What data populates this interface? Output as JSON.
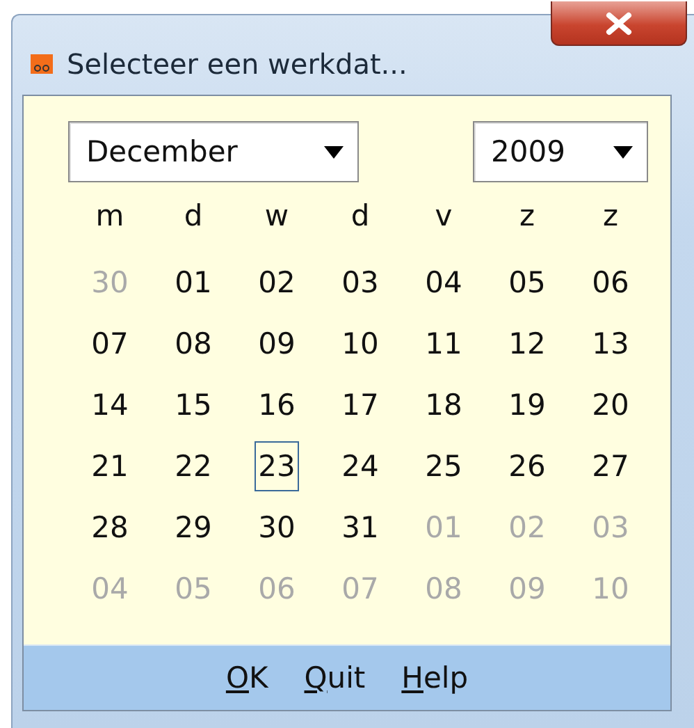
{
  "window": {
    "title": "Selecteer een werkdat..."
  },
  "month_select": {
    "value": "December"
  },
  "year_select": {
    "value": "2009"
  },
  "weekdays": [
    "m",
    "d",
    "w",
    "d",
    "v",
    "z",
    "z"
  ],
  "weeks": [
    [
      {
        "label": "30",
        "in_month": false,
        "selected": false
      },
      {
        "label": "01",
        "in_month": true,
        "selected": false
      },
      {
        "label": "02",
        "in_month": true,
        "selected": false
      },
      {
        "label": "03",
        "in_month": true,
        "selected": false
      },
      {
        "label": "04",
        "in_month": true,
        "selected": false
      },
      {
        "label": "05",
        "in_month": true,
        "selected": false
      },
      {
        "label": "06",
        "in_month": true,
        "selected": false
      }
    ],
    [
      {
        "label": "07",
        "in_month": true,
        "selected": false
      },
      {
        "label": "08",
        "in_month": true,
        "selected": false
      },
      {
        "label": "09",
        "in_month": true,
        "selected": false
      },
      {
        "label": "10",
        "in_month": true,
        "selected": false
      },
      {
        "label": "11",
        "in_month": true,
        "selected": false
      },
      {
        "label": "12",
        "in_month": true,
        "selected": false
      },
      {
        "label": "13",
        "in_month": true,
        "selected": false
      }
    ],
    [
      {
        "label": "14",
        "in_month": true,
        "selected": false
      },
      {
        "label": "15",
        "in_month": true,
        "selected": false
      },
      {
        "label": "16",
        "in_month": true,
        "selected": false
      },
      {
        "label": "17",
        "in_month": true,
        "selected": false
      },
      {
        "label": "18",
        "in_month": true,
        "selected": false
      },
      {
        "label": "19",
        "in_month": true,
        "selected": false
      },
      {
        "label": "20",
        "in_month": true,
        "selected": false
      }
    ],
    [
      {
        "label": "21",
        "in_month": true,
        "selected": false
      },
      {
        "label": "22",
        "in_month": true,
        "selected": false
      },
      {
        "label": "23",
        "in_month": true,
        "selected": true
      },
      {
        "label": "24",
        "in_month": true,
        "selected": false
      },
      {
        "label": "25",
        "in_month": true,
        "selected": false
      },
      {
        "label": "26",
        "in_month": true,
        "selected": false
      },
      {
        "label": "27",
        "in_month": true,
        "selected": false
      }
    ],
    [
      {
        "label": "28",
        "in_month": true,
        "selected": false
      },
      {
        "label": "29",
        "in_month": true,
        "selected": false
      },
      {
        "label": "30",
        "in_month": true,
        "selected": false
      },
      {
        "label": "31",
        "in_month": true,
        "selected": false
      },
      {
        "label": "01",
        "in_month": false,
        "selected": false
      },
      {
        "label": "02",
        "in_month": false,
        "selected": false
      },
      {
        "label": "03",
        "in_month": false,
        "selected": false
      }
    ],
    [
      {
        "label": "04",
        "in_month": false,
        "selected": false
      },
      {
        "label": "05",
        "in_month": false,
        "selected": false
      },
      {
        "label": "06",
        "in_month": false,
        "selected": false
      },
      {
        "label": "07",
        "in_month": false,
        "selected": false
      },
      {
        "label": "08",
        "in_month": false,
        "selected": false
      },
      {
        "label": "09",
        "in_month": false,
        "selected": false
      },
      {
        "label": "10",
        "in_month": false,
        "selected": false
      }
    ]
  ],
  "buttons": [
    "OK",
    "Quit",
    "Help"
  ]
}
